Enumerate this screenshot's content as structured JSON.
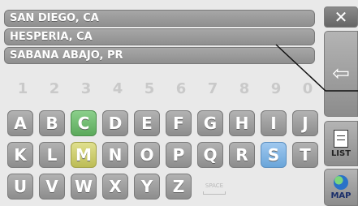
{
  "results": [
    "SAN DIEGO, CA",
    "HESPERIA, CA",
    "SABANA ABAJO, PR"
  ],
  "side": {
    "close_label": "✕",
    "back_label": "⇦",
    "list_label": "LIST",
    "map_label": "MAP"
  },
  "digits": [
    "1",
    "2",
    "3",
    "4",
    "5",
    "6",
    "7",
    "8",
    "9",
    "0"
  ],
  "keyboard": {
    "row1": [
      "A",
      "B",
      "C",
      "D",
      "E",
      "F",
      "G",
      "H",
      "I",
      "J"
    ],
    "row2": [
      "K",
      "L",
      "M",
      "N",
      "O",
      "P",
      "Q",
      "R",
      "S",
      "T"
    ],
    "row3": [
      "U",
      "V",
      "W",
      "X",
      "Y",
      "Z"
    ],
    "space_label": "SPACE",
    "highlighted": {
      "C": "green",
      "M": "yellow",
      "S": "blue"
    }
  }
}
